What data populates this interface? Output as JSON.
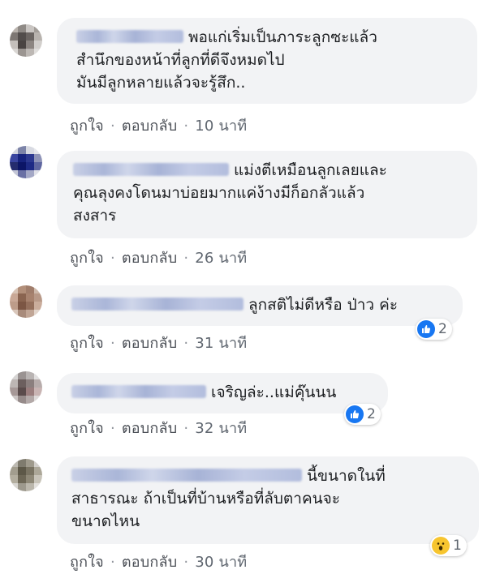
{
  "comments": [
    {
      "text": "พอแก่เริ่มเป็นภาระลูกซะแล้ว\nสำนึกของหน้าที่ลูกที่ดีจึงหมดไป\nมันมีลูกหลายแล้วจะรู้สึก..",
      "actions": {
        "like": "ถูกใจ",
        "reply": "ตอบกลับ",
        "time": "10 นาที"
      }
    },
    {
      "text": "แม่งตีเหมือนลูกเลยและ\nคุณลุงคงโดนมาบ่อยมากแค่ง้างมีก็อกลัวแล้ว\nสงสาร",
      "actions": {
        "like": "ถูกใจ",
        "reply": "ตอบกลับ",
        "time": "26 นาที"
      }
    },
    {
      "text": "ลูกสติไม่ดีหรือ ป่าว ค่ะ",
      "actions": {
        "like": "ถูกใจ",
        "reply": "ตอบกลับ",
        "time": "31 นาที"
      },
      "reaction": {
        "icon": "like-icon",
        "count": "2"
      }
    },
    {
      "text": "เจริญล่ะ..แม่คุ๊นนน",
      "actions": {
        "like": "ถูกใจ",
        "reply": "ตอบกลับ",
        "time": "32 นาที"
      },
      "reaction": {
        "icon": "like-icon",
        "count": "2"
      }
    },
    {
      "text": "นี้ขนาดในที่\nสาธารณะ ถ้าเป็นที่บ้านหรือที่ลับตาคนจะ\nขนาดไหน",
      "actions": {
        "like": "ถูกใจ",
        "reply": "ตอบกลับ",
        "time": "30 นาที"
      },
      "reaction": {
        "icon": "wow-icon",
        "count": "1"
      }
    }
  ],
  "colors": {
    "bubble": "#f2f3f5",
    "link": "#4b4f56",
    "meta": "#606770",
    "like": "#1877f2",
    "wow": "#f7c52f"
  }
}
